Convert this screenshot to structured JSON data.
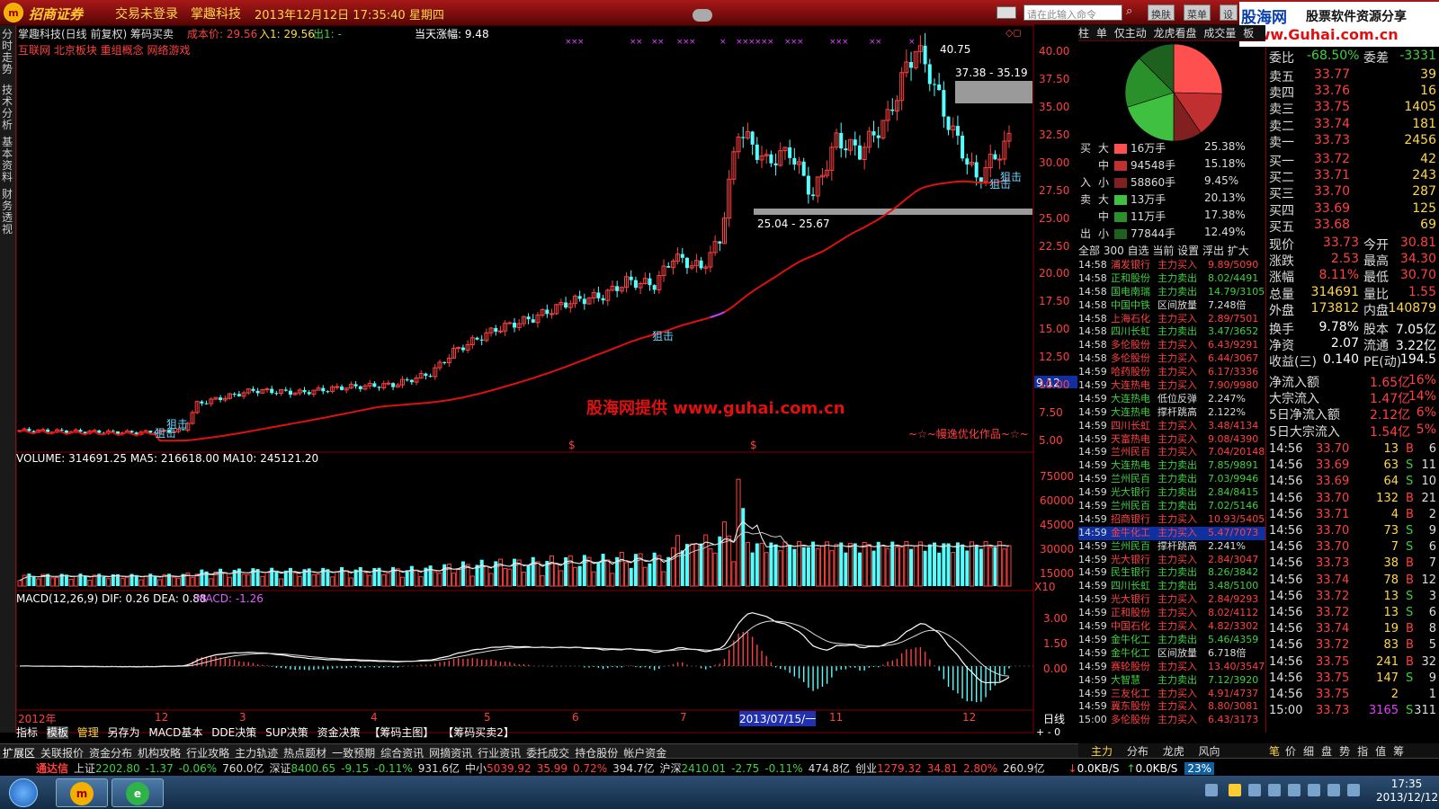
{
  "window": {
    "brand": "招商证券",
    "status": "交易未登录",
    "stock": "掌趣科技",
    "datetime": "2013年12月12日 17:35:40 星期四",
    "command_placeholder": "请在此输入命令",
    "buttons": [
      "换肤",
      "菜单",
      "设置"
    ],
    "ad_line1": "股海网",
    "ad_line2": "股票软件资源分享",
    "ad_url": "Www.Guhai.com.cn"
  },
  "sidebar": [
    "分时走势",
    "技术分析",
    "基本资料",
    "财务透视"
  ],
  "chart_header": {
    "title": "掌趣科技(日线 前复权) 筹码买卖",
    "cost_label": "成本价: 29.56",
    "in_label": "入1: 29.56",
    "out_label": "出1: -",
    "today_range": "当天涨幅: 9.48",
    "concepts": "互联网 北京板块 重组概念 网络游戏"
  },
  "annotations": {
    "high": "40.75",
    "upper_band": "37.38 - 35.19",
    "lower_band": "25.04 - 25.67",
    "snipe": "狙击",
    "watermark": "股海网提供 www.guhai.com.cn",
    "author": "~☆~幔逸优化作品~☆~",
    "price_marker": "9.12",
    "dollar": "$",
    "xs": "×××"
  },
  "price_axis": [
    "40.00",
    "37.50",
    "35.00",
    "32.50",
    "30.00",
    "27.50",
    "25.00",
    "22.50",
    "20.00",
    "17.50",
    "15.00",
    "12.50",
    "10.00",
    "7.50",
    "5.00"
  ],
  "volume_header": "VOLUME: 314691.25 MA5: 216618.00 MA10: 245121.20",
  "volume_axis": [
    "75000",
    "60000",
    "45000",
    "30000",
    "15000",
    "X10"
  ],
  "macd_header_main": "MACD(12,26,9) DIF: 0.26 DEA: 0.88",
  "macd_header_val": "MACD: -1.26",
  "macd_axis": [
    "3.00",
    "1.50",
    "0.00"
  ],
  "x_axis": [
    "2012年",
    "12",
    "3",
    "4",
    "5",
    "6",
    "7",
    "2013/07/15/一",
    "11",
    "12"
  ],
  "axis_corner": "日线",
  "tool_tabs": [
    "指标",
    "模板",
    "管理",
    "另存为",
    "MACD基本",
    "DDE决策",
    "SUP决策",
    "资金决策",
    "【筹码主图】",
    "【筹码买卖2】"
  ],
  "bottom_tabs": [
    "扩展区",
    "关联报价",
    "资金分布",
    "机构攻略",
    "行业攻略",
    "主力轨迹",
    "热点题材",
    "一致预期",
    "综合资讯",
    "网摘资讯",
    "行业资讯",
    "委托成交",
    "持仓股份",
    "帐户资金"
  ],
  "right_bottom_tabs": [
    "主力",
    "分布",
    "龙虎",
    "风向"
  ],
  "book_bottom_tabs": [
    "笔",
    "价",
    "细",
    "盘",
    "势",
    "指",
    "值",
    "筹"
  ],
  "right_tabs": [
    "柱",
    "单",
    "仅主动",
    "龙虎看盘",
    "成交量",
    "板"
  ],
  "chart_data": {
    "type": "pie",
    "title": "",
    "labels": [
      "买入大",
      "买入中",
      "买入小",
      "卖出大",
      "卖出中",
      "卖出小"
    ],
    "values": [
      25.38,
      15.18,
      9.45,
      20.13,
      17.38,
      12.49
    ]
  },
  "flow": [
    {
      "side": "买",
      "lab": "大",
      "amt": "16万手",
      "pct": "25.38%",
      "color": "#ff5050"
    },
    {
      "side": "",
      "lab": "中",
      "amt": "94548手",
      "pct": "15.18%",
      "color": "#c03030"
    },
    {
      "side": "入",
      "lab": "小",
      "amt": "58860手",
      "pct": "9.45%",
      "color": "#802020"
    },
    {
      "side": "卖",
      "lab": "大",
      "amt": "13万手",
      "pct": "20.13%",
      "color": "#40c040"
    },
    {
      "side": "",
      "lab": "中",
      "amt": "11万手",
      "pct": "17.38%",
      "color": "#2a902a"
    },
    {
      "side": "出",
      "lab": "小",
      "amt": "77844手",
      "pct": "12.49%",
      "color": "#1e601e"
    }
  ],
  "scan_header": "全部 300 自选 当前 设置 浮出 扩大",
  "scan": [
    [
      "14:58",
      "浦发银行",
      "主力买入",
      "9.89/5090"
    ],
    [
      "14:58",
      "正和股份",
      "主力卖出",
      "8.02/4491"
    ],
    [
      "14:58",
      "国电南瑞",
      "主力卖出",
      "14.79/3105"
    ],
    [
      "14:58",
      "中国中铁",
      "区间放量",
      "7.248倍"
    ],
    [
      "14:58",
      "上海石化",
      "主力买入",
      "2.89/7501"
    ],
    [
      "14:58",
      "四川长虹",
      "主力卖出",
      "3.47/3652"
    ],
    [
      "14:58",
      "多伦股份",
      "主力买入",
      "6.43/9291"
    ],
    [
      "14:58",
      "多伦股份",
      "主力买入",
      "6.44/3067"
    ],
    [
      "14:59",
      "哈药股份",
      "主力买入",
      "6.17/3336"
    ],
    [
      "14:59",
      "大连热电",
      "主力买入",
      "7.90/9980"
    ],
    [
      "14:59",
      "大连热电",
      "低位反弹",
      "2.247%"
    ],
    [
      "14:59",
      "大连热电",
      "撑杆跳高",
      "2.122%"
    ],
    [
      "14:59",
      "四川长虹",
      "主力买入",
      "3.48/4134"
    ],
    [
      "14:59",
      "天富热电",
      "主力买入",
      "9.08/4390"
    ],
    [
      "14:59",
      "兰州民百",
      "主力买入",
      "7.04/20148"
    ],
    [
      "14:59",
      "大连热电",
      "主力卖出",
      "7.85/9891"
    ],
    [
      "14:59",
      "兰州民百",
      "主力卖出",
      "7.03/9946"
    ],
    [
      "14:59",
      "光大银行",
      "主力卖出",
      "2.84/8415"
    ],
    [
      "14:59",
      "兰州民百",
      "主力卖出",
      "7.02/5146"
    ],
    [
      "14:59",
      "招商银行",
      "主力买入",
      "10.93/5405"
    ],
    [
      "14:59",
      "金牛化工",
      "主力买入",
      "5.47/7073"
    ],
    [
      "14:59",
      "兰州民百",
      "撑杆跳高",
      "2.241%"
    ],
    [
      "14:59",
      "光大银行",
      "主力买入",
      "2.84/3047"
    ],
    [
      "14:59",
      "民生银行",
      "主力卖出",
      "8.26/3842"
    ],
    [
      "14:59",
      "四川长虹",
      "主力卖出",
      "3.48/5100"
    ],
    [
      "14:59",
      "光大银行",
      "主力买入",
      "2.84/9293"
    ],
    [
      "14:59",
      "正和股份",
      "主力买入",
      "8.02/4112"
    ],
    [
      "14:59",
      "中国石化",
      "主力买入",
      "4.82/3302"
    ],
    [
      "14:59",
      "金牛化工",
      "主力卖出",
      "5.46/4359"
    ],
    [
      "14:59",
      "金牛化工",
      "区间放量",
      "6.718倍"
    ],
    [
      "14:59",
      "赛轮股份",
      "主力买入",
      "13.40/3547"
    ],
    [
      "14:59",
      "大智慧",
      "主力卖出",
      "7.12/3920"
    ],
    [
      "14:59",
      "三友化工",
      "主力买入",
      "4.91/4737"
    ],
    [
      "14:59",
      "冀东股份",
      "主力买入",
      "8.80/3081"
    ],
    [
      "15:00",
      "多伦股份",
      "主力买入",
      "6.43/3173"
    ]
  ],
  "book": {
    "weibi": [
      "委比",
      "-68.50%",
      "委差",
      "-3331"
    ],
    "asks": [
      [
        "卖五",
        "33.77",
        "39"
      ],
      [
        "卖四",
        "33.76",
        "16"
      ],
      [
        "卖三",
        "33.75",
        "1405"
      ],
      [
        "卖二",
        "33.74",
        "181"
      ],
      [
        "卖一",
        "33.73",
        "2456"
      ]
    ],
    "bids": [
      [
        "买一",
        "33.72",
        "42"
      ],
      [
        "买二",
        "33.71",
        "243"
      ],
      [
        "买三",
        "33.70",
        "287"
      ],
      [
        "买四",
        "33.69",
        "125"
      ],
      [
        "买五",
        "33.68",
        "69"
      ]
    ],
    "quote": [
      [
        "现价",
        "33.73",
        "今开",
        "30.81"
      ],
      [
        "涨跌",
        "2.53",
        "最高",
        "34.30"
      ],
      [
        "涨幅",
        "8.11%",
        "最低",
        "30.70"
      ],
      [
        "总量",
        "314691",
        "量比",
        "1.55"
      ],
      [
        "外盘",
        "173812",
        "内盘",
        "140879"
      ]
    ],
    "fund": [
      [
        "换手",
        "9.78%",
        "股本",
        "7.05亿"
      ],
      [
        "净资",
        "2.07",
        "流通",
        "3.22亿"
      ],
      [
        "收益(三)",
        "0.140",
        "PE(动)",
        "194.5"
      ]
    ],
    "flows": [
      [
        "净流入额",
        "1.65亿",
        "16%"
      ],
      [
        "大宗流入",
        "1.47亿",
        "14%"
      ],
      [
        "5日净流入额",
        "2.12亿",
        "6%"
      ],
      [
        "5日大宗流入",
        "1.54亿",
        "5%"
      ]
    ],
    "ticks": [
      [
        "14:56",
        "33.70",
        "13",
        "B",
        "6"
      ],
      [
        "14:56",
        "33.69",
        "63",
        "S",
        "11"
      ],
      [
        "14:56",
        "33.69",
        "64",
        "S",
        "10"
      ],
      [
        "14:56",
        "33.70",
        "132",
        "B",
        "21"
      ],
      [
        "14:56",
        "33.71",
        "4",
        "B",
        "2"
      ],
      [
        "14:56",
        "33.70",
        "73",
        "S",
        "9"
      ],
      [
        "14:56",
        "33.70",
        "7",
        "S",
        "6"
      ],
      [
        "14:56",
        "33.73",
        "38",
        "B",
        "7"
      ],
      [
        "14:56",
        "33.74",
        "78",
        "B",
        "12"
      ],
      [
        "14:56",
        "33.72",
        "13",
        "S",
        "3"
      ],
      [
        "14:56",
        "33.72",
        "13",
        "S",
        "6"
      ],
      [
        "14:56",
        "33.74",
        "19",
        "B",
        "8"
      ],
      [
        "14:56",
        "33.72",
        "83",
        "B",
        "5"
      ],
      [
        "14:56",
        "33.75",
        "241",
        "B",
        "32"
      ],
      [
        "14:56",
        "33.75",
        "147",
        "S",
        "9"
      ],
      [
        "14:56",
        "33.75",
        "2",
        "",
        "1"
      ],
      [
        "15:00",
        "33.73",
        "3165",
        "S",
        "311"
      ]
    ]
  },
  "ticker": {
    "app": "通达信",
    "items": [
      [
        "上证",
        "2202.80",
        "-1.37",
        "-0.06%",
        "760.0亿"
      ],
      [
        "深证",
        "8400.65",
        "-9.15",
        "-0.11%",
        "931.6亿"
      ],
      [
        "中小",
        "5039.92",
        "35.99",
        "0.72%",
        "394.7亿"
      ],
      [
        "沪深",
        "2410.01",
        "-2.75",
        "-0.11%",
        "474.8亿"
      ],
      [
        "创业",
        "1279.32",
        "34.81",
        "2.80%",
        "260.9亿"
      ]
    ],
    "net_down": "0.0KB/S",
    "net_up": "0.0KB/S",
    "cpu": "23%"
  },
  "taskbar": {
    "time": "17:35",
    "date": "2013/12/12"
  }
}
